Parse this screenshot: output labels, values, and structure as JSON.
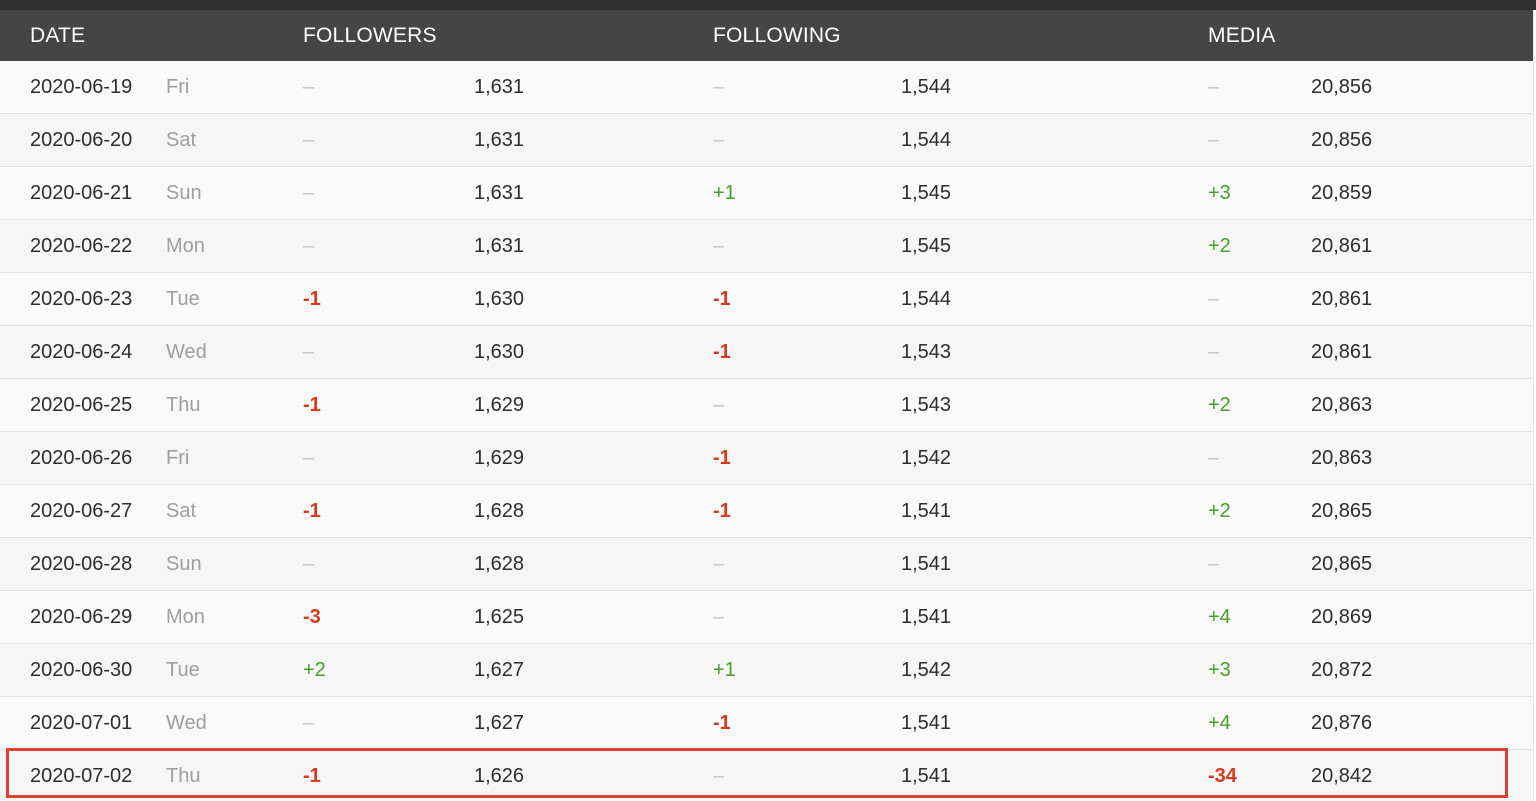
{
  "header": {
    "date": "DATE",
    "followers": "FOLLOWERS",
    "following": "FOLLOWING",
    "media": "MEDIA"
  },
  "colors": {
    "header_bg": "#454545",
    "positive": "#4a9d2a",
    "negative": "#d63b1f",
    "highlight": "#e04030"
  },
  "rows": [
    {
      "date": "2020-06-19",
      "day": "Fri",
      "followers_delta": "–",
      "followers": "1,631",
      "following_delta": "–",
      "following": "1,544",
      "media_delta": "–",
      "media": "20,856"
    },
    {
      "date": "2020-06-20",
      "day": "Sat",
      "followers_delta": "–",
      "followers": "1,631",
      "following_delta": "–",
      "following": "1,544",
      "media_delta": "–",
      "media": "20,856"
    },
    {
      "date": "2020-06-21",
      "day": "Sun",
      "followers_delta": "–",
      "followers": "1,631",
      "following_delta": "+1",
      "following": "1,545",
      "media_delta": "+3",
      "media": "20,859"
    },
    {
      "date": "2020-06-22",
      "day": "Mon",
      "followers_delta": "–",
      "followers": "1,631",
      "following_delta": "–",
      "following": "1,545",
      "media_delta": "+2",
      "media": "20,861"
    },
    {
      "date": "2020-06-23",
      "day": "Tue",
      "followers_delta": "-1",
      "followers": "1,630",
      "following_delta": "-1",
      "following": "1,544",
      "media_delta": "–",
      "media": "20,861"
    },
    {
      "date": "2020-06-24",
      "day": "Wed",
      "followers_delta": "–",
      "followers": "1,630",
      "following_delta": "-1",
      "following": "1,543",
      "media_delta": "–",
      "media": "20,861"
    },
    {
      "date": "2020-06-25",
      "day": "Thu",
      "followers_delta": "-1",
      "followers": "1,629",
      "following_delta": "–",
      "following": "1,543",
      "media_delta": "+2",
      "media": "20,863"
    },
    {
      "date": "2020-06-26",
      "day": "Fri",
      "followers_delta": "–",
      "followers": "1,629",
      "following_delta": "-1",
      "following": "1,542",
      "media_delta": "–",
      "media": "20,863"
    },
    {
      "date": "2020-06-27",
      "day": "Sat",
      "followers_delta": "-1",
      "followers": "1,628",
      "following_delta": "-1",
      "following": "1,541",
      "media_delta": "+2",
      "media": "20,865"
    },
    {
      "date": "2020-06-28",
      "day": "Sun",
      "followers_delta": "–",
      "followers": "1,628",
      "following_delta": "–",
      "following": "1,541",
      "media_delta": "–",
      "media": "20,865"
    },
    {
      "date": "2020-06-29",
      "day": "Mon",
      "followers_delta": "-3",
      "followers": "1,625",
      "following_delta": "–",
      "following": "1,541",
      "media_delta": "+4",
      "media": "20,869"
    },
    {
      "date": "2020-06-30",
      "day": "Tue",
      "followers_delta": "+2",
      "followers": "1,627",
      "following_delta": "+1",
      "following": "1,542",
      "media_delta": "+3",
      "media": "20,872"
    },
    {
      "date": "2020-07-01",
      "day": "Wed",
      "followers_delta": "–",
      "followers": "1,627",
      "following_delta": "-1",
      "following": "1,541",
      "media_delta": "+4",
      "media": "20,876"
    },
    {
      "date": "2020-07-02",
      "day": "Thu",
      "followers_delta": "-1",
      "followers": "1,626",
      "following_delta": "–",
      "following": "1,541",
      "media_delta": "-34",
      "media": "20,842"
    }
  ]
}
